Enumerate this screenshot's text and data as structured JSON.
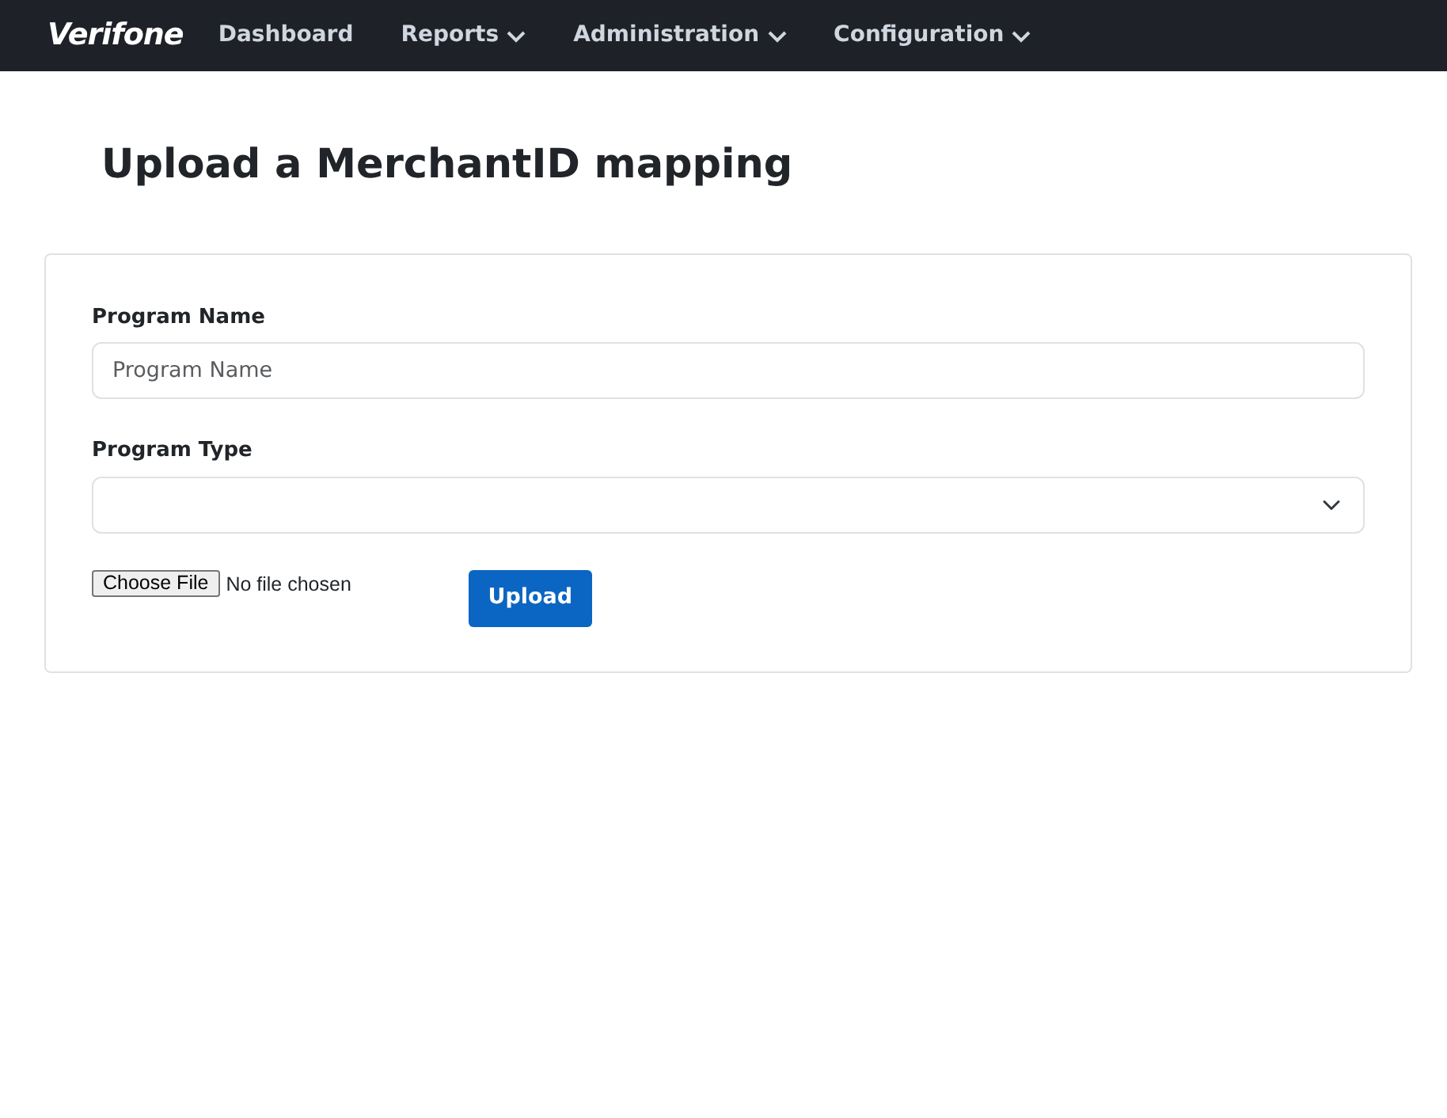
{
  "navbar": {
    "logo": "Verifone",
    "items": [
      {
        "label": "Dashboard",
        "dropdown": false
      },
      {
        "label": "Reports",
        "dropdown": true
      },
      {
        "label": "Administration",
        "dropdown": true
      },
      {
        "label": "Configuration",
        "dropdown": true
      }
    ]
  },
  "page": {
    "title": "Upload a MerchantID mapping"
  },
  "form": {
    "fields": [
      {
        "kind": "text",
        "label": "Program Name",
        "placeholder": "Program Name"
      },
      {
        "kind": "select",
        "label": "Program Type"
      }
    ],
    "file": {
      "button": "Choose File",
      "status": "No file chosen"
    },
    "submit": "Upload"
  }
}
